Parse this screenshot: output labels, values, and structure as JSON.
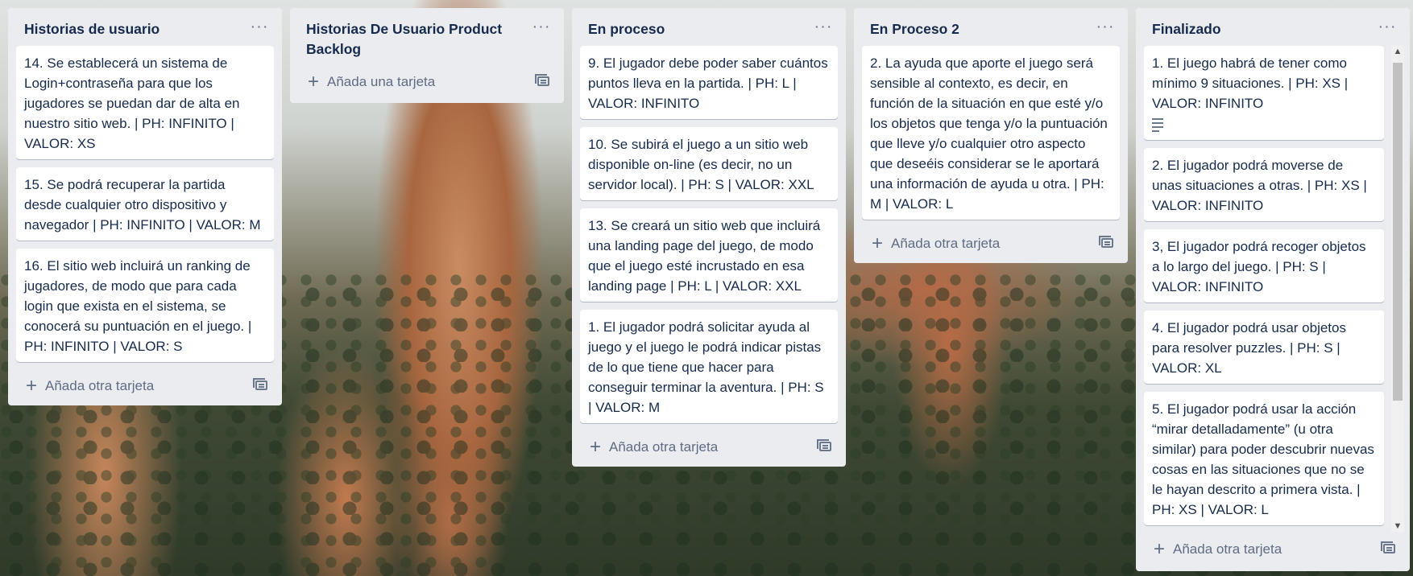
{
  "lists": [
    {
      "title": "Historias de usuario",
      "cards": [
        {
          "text": "14. Se establecerá un sistema de Login+contraseña para que los jugadores se puedan dar de alta en nuestro sitio web. | PH: INFINITO | VALOR: XS"
        },
        {
          "text": "15. Se podrá recuperar la partida desde cualquier otro dispositivo y navegador | PH: INFINITO | VALOR: M"
        },
        {
          "text": "16. El sitio web incluirá un ranking de jugadores, de modo que para cada login que exista en el sistema, se conocerá su puntuación en el juego. | PH: INFINITO | VALOR: S"
        }
      ],
      "add_label": "Añada otra tarjeta"
    },
    {
      "title": "Historias De Usuario Product Backlog",
      "cards": [],
      "add_label": "Añada una tarjeta"
    },
    {
      "title": "En proceso",
      "cards": [
        {
          "text": "9. El jugador debe poder saber cuántos puntos lleva en la partida. | PH: L | VALOR: INFINITO"
        },
        {
          "text": "10. Se subirá el juego a un sitio web disponible on-line (es decir, no un servidor local). | PH: S | VALOR: XXL"
        },
        {
          "text": "13. Se creará un sitio web que incluirá una landing page del juego, de modo que el juego esté incrustado en esa landing page | PH: L | VALOR: XXL"
        },
        {
          "text": "1. El jugador podrá solicitar ayuda al juego y el juego le podrá indicar pistas de lo que tiene que hacer para conseguir terminar la aventura. | PH: S | VALOR: M"
        }
      ],
      "add_label": "Añada otra tarjeta"
    },
    {
      "title": "En Proceso 2",
      "cards": [
        {
          "text": "2. La ayuda que aporte el juego será sensible al contexto, es decir, en función de la situación en que esté y/o los objetos que tenga y/o la puntuación que lleve y/o cualquier otro aspecto que deseéis considerar se le aportará una información de ayuda u otra. | PH: M | VALOR: L"
        }
      ],
      "add_label": "Añada otra tarjeta"
    },
    {
      "title": "Finalizado",
      "cards": [
        {
          "text": "1. El juego habrá de tener como mínimo 9 situaciones. | PH: XS | VALOR: INFINITO",
          "has_description": true
        },
        {
          "text": "2. El jugador podrá moverse de unas situaciones a otras. | PH: XS | VALOR: INFINITO"
        },
        {
          "text": "3, El jugador podrá recoger objetos a lo largo del juego. | PH: S | VALOR: INFINITO"
        },
        {
          "text": "4. El jugador podrá usar objetos para resolver puzzles. | PH: S | VALOR: XL"
        },
        {
          "text": "5. El jugador podrá usar la acción “mirar detalladamente” (u otra similar) para poder descubrir nuevas cosas en las situaciones que no se le hayan descrito a primera vista. | PH: XS | VALOR: L"
        }
      ],
      "add_label": "Añada otra tarjeta"
    }
  ],
  "icons": {
    "list_menu": "ellipsis-icon",
    "add": "plus-icon",
    "template": "card-template-icon",
    "description": "description-icon"
  }
}
